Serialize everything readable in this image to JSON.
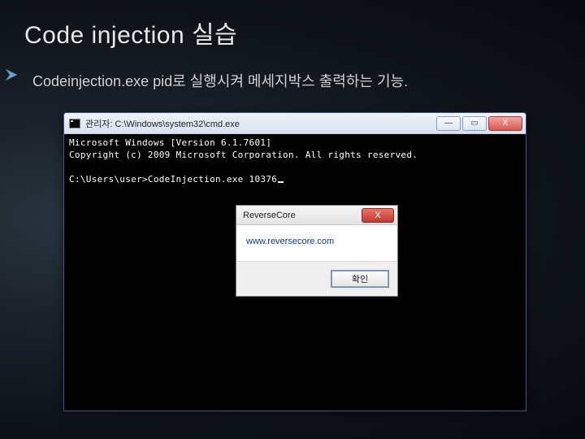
{
  "slide": {
    "title": "Code injection 실습",
    "subtitle": "Codeinjection.exe  pid로 실행시켜 메세지박스 출력하는 기능."
  },
  "cmd": {
    "title": "관리자: C:\\Windows\\system32\\cmd.exe",
    "line1": "Microsoft Windows [Version 6.1.7601]",
    "line2": "Copyright (c) 2009 Microsoft Corporation. All rights reserved.",
    "prompt": "C:\\Users\\user>CodeInjection.exe 10376",
    "buttons": {
      "min": "—",
      "max": "▭",
      "close": "X"
    }
  },
  "msgbox": {
    "title": "ReverseCore",
    "message": "www.reversecore.com",
    "ok": "확인",
    "close": "X"
  }
}
